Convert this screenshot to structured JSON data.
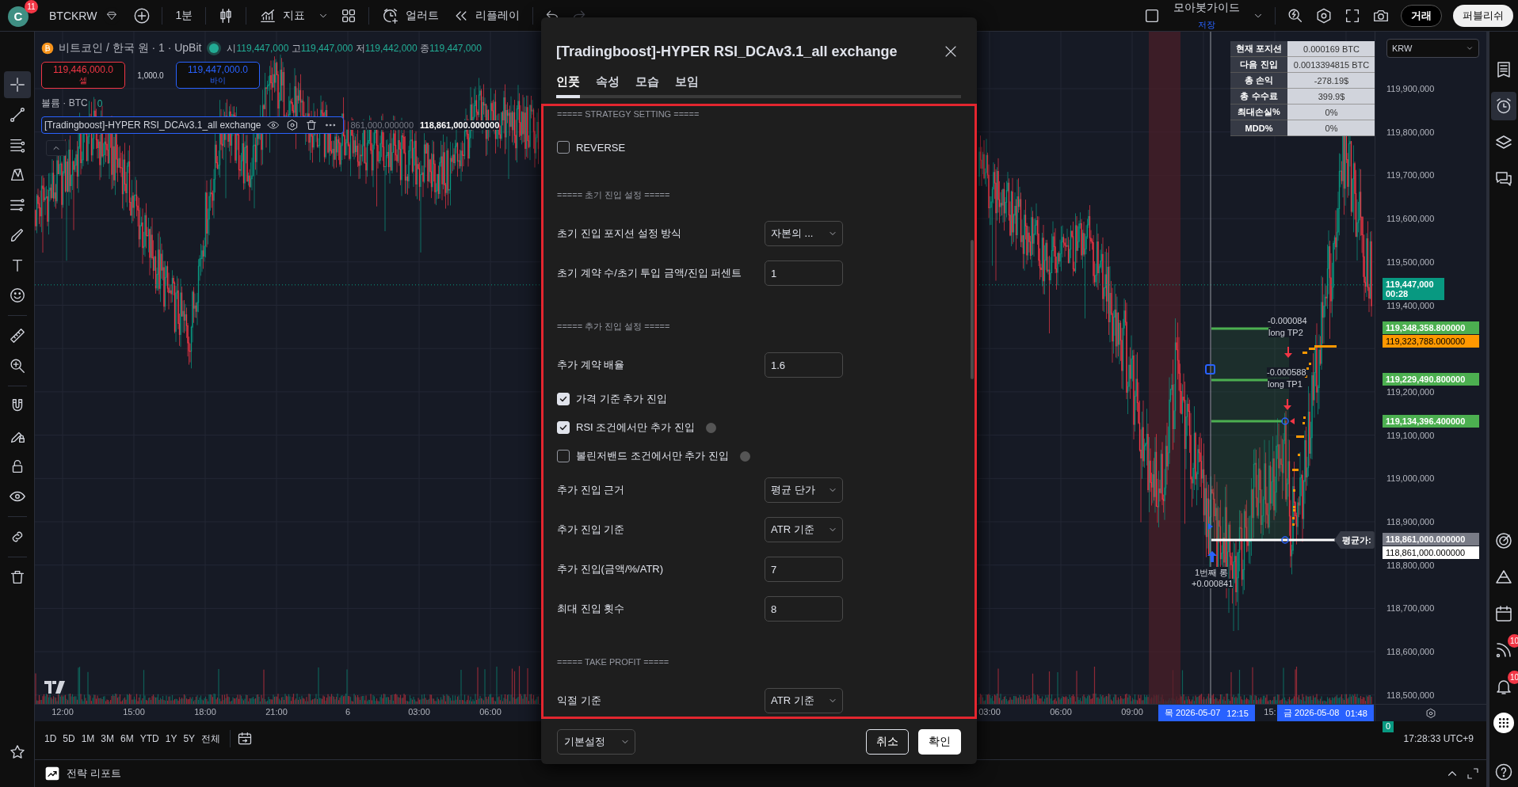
{
  "top_bar": {
    "avatar": "C",
    "avatar_badge": "11",
    "symbol": "BTCKRW",
    "interval": "1분",
    "indicators": "지표",
    "alert": "얼러트",
    "replay": "리플레이",
    "layout_name": "모아봇가이드",
    "save_status": "저장",
    "trade_button": "거래",
    "publish_button": "퍼블리쉬"
  },
  "left_toolbar": [
    {
      "kind": "crosshair",
      "selected": true
    },
    {
      "kind": "trend-line",
      "selected": false
    },
    {
      "kind": "fib",
      "selected": false
    },
    {
      "kind": "pattern",
      "selected": false
    },
    {
      "kind": "forecast",
      "selected": false
    },
    {
      "kind": "brush",
      "selected": false
    },
    {
      "kind": "text",
      "selected": false
    },
    {
      "kind": "emoji",
      "selected": false
    },
    {
      "kind": "ruler",
      "selected": false
    },
    {
      "kind": "zoom",
      "selected": false
    },
    {
      "kind": "magnet",
      "selected": false
    },
    {
      "kind": "lock-draw",
      "selected": false
    },
    {
      "kind": "lock",
      "selected": false
    },
    {
      "kind": "eye",
      "selected": false
    },
    {
      "kind": "link",
      "selected": false
    },
    {
      "kind": "trash",
      "selected": false
    },
    {
      "kind": "star",
      "selected": false
    }
  ],
  "legend": {
    "title": "비트코인 / 한국 원 · 1 · UpBit",
    "ohlc": [
      {
        "label": "시",
        "value": "119,447,000"
      },
      {
        "label": "고",
        "value": "119,447,000"
      },
      {
        "label": "저",
        "value": "119,442,000"
      },
      {
        "label": "종",
        "value": "119,447,000"
      }
    ],
    "sell": {
      "price": "119,446,000.0",
      "label": "셀"
    },
    "spread": "1,000.0",
    "buy": {
      "price": "119,447,000.0",
      "label": "바이"
    },
    "volume": {
      "label": "볼륨 · BTC",
      "value": "0"
    },
    "indicator": {
      "name": "[Tradingboost]-HYPER RSI_DCAv3.1_all exchange",
      "value_1": "861,000.000000",
      "value_2": "118,861,000.000000"
    }
  },
  "position_table": [
    {
      "label": "현재 포지션",
      "value": "0.000169 BTC"
    },
    {
      "label": "다음 진입",
      "value": "0.0013394815 BTC"
    },
    {
      "label": "총 손익",
      "value": "-278.19$"
    },
    {
      "label": "총 수수료",
      "value": "399.9$"
    },
    {
      "label": "최대손실%",
      "value": "0%"
    },
    {
      "label": "MDD%",
      "value": "0%"
    }
  ],
  "chart_marks": {
    "take_profits": [
      {
        "amount": "-0.000084",
        "label": "long TP2"
      },
      {
        "amount": "-0.000588",
        "label": "long TP1"
      }
    ],
    "entry": {
      "title": "1번째 롱",
      "amount": "+0.000841"
    },
    "average_tag": "평균가:"
  },
  "price_axis": {
    "currency": "KRW",
    "ticks": [
      "119,900,000",
      "119,800,000",
      "119,700,000",
      "119,600,000",
      "119,500,000",
      "119,400,000",
      "119,200,000",
      "119,100,000",
      "119,000,000",
      "118,900,000",
      "118,800,000",
      "118,700,000",
      "118,600,000",
      "118,500,000"
    ],
    "tags": [
      {
        "kind": "last",
        "price": "119,447,000",
        "countdown": "00:28"
      },
      {
        "kind": "profit",
        "price": "119,348,358.800000"
      },
      {
        "kind": "order",
        "price": "119,323,788.000000"
      },
      {
        "kind": "profit",
        "price": "119,229,490.800000"
      },
      {
        "kind": "profit",
        "price": "119,134,396.400000"
      },
      {
        "kind": "average",
        "price": "118,861,000.000000"
      },
      {
        "kind": "plain",
        "price": "118,861,000.000000"
      }
    ],
    "volume_tag": "0"
  },
  "time_axis": {
    "ticks": [
      "12:00",
      "15:00",
      "18:00",
      "21:00",
      "6",
      "03:00",
      "06:00",
      "03:00",
      "06:00",
      "09:00"
    ],
    "partial_tick": "15:",
    "cursors": [
      {
        "day": "목",
        "date": "2026-05-07",
        "time": "12:15"
      },
      {
        "day": "금",
        "date": "2026-05-08",
        "time": "01:48"
      }
    ]
  },
  "ranges": [
    "1D",
    "5D",
    "1M",
    "3M",
    "6M",
    "YTD",
    "1Y",
    "5Y",
    "전체"
  ],
  "clock": "17:28:33 UTC+9",
  "bottom_panel": {
    "title": "전략 리포트"
  },
  "right_toolbar": [
    {
      "kind": "watchlist",
      "selected": false
    },
    {
      "kind": "alerts",
      "selected": true
    },
    {
      "kind": "layers",
      "selected": false
    },
    {
      "kind": "chat",
      "selected": false
    },
    {
      "kind": "target",
      "selected": false
    },
    {
      "kind": "triangles",
      "selected": false
    },
    {
      "kind": "calendar",
      "selected": false
    },
    {
      "kind": "signal",
      "selected": false,
      "badge": "10"
    },
    {
      "kind": "bell",
      "selected": false,
      "badge": "10"
    },
    {
      "kind": "apps",
      "selected": false
    },
    {
      "kind": "help",
      "selected": false
    }
  ],
  "dialog": {
    "title": "[Tradingboost]-HYPER RSI_DCAv3.1_all exchange",
    "tabs": [
      {
        "label": "인풋",
        "selected": true
      },
      {
        "label": "속성",
        "selected": false
      },
      {
        "label": "모습",
        "selected": false
      },
      {
        "label": "보임",
        "selected": false
      }
    ],
    "inputs": [
      {
        "kind": "section",
        "text": "===== STRATEGY SETTING ====="
      },
      {
        "kind": "checkbox",
        "label": "REVERSE",
        "checked": false,
        "info": false
      },
      {
        "kind": "section",
        "text": "===== 초기 진입 설정 ====="
      },
      {
        "kind": "select",
        "label": "초기 진입 포지션 설정 방식",
        "value": "자본의 ..."
      },
      {
        "kind": "number",
        "label": "초기 계약 수/초기 투입 금액/진입 퍼센트",
        "value": "1"
      },
      {
        "kind": "section",
        "text": "===== 추가 진입 설정 ====="
      },
      {
        "kind": "number",
        "label": "추가 계약 배율",
        "value": "1.6"
      },
      {
        "kind": "checkbox",
        "label": "가격 기준 추가 진입",
        "checked": true,
        "info": false
      },
      {
        "kind": "checkbox",
        "label": "RSI 조건에서만 추가 진입",
        "checked": true,
        "info": true
      },
      {
        "kind": "checkbox",
        "label": "볼린저밴드 조건에서만 추가 진입",
        "checked": false,
        "info": true
      },
      {
        "kind": "select",
        "label": "추가 진입 근거",
        "value": "평균 단가"
      },
      {
        "kind": "select",
        "label": "추가 진입 기준",
        "value": "ATR 기준"
      },
      {
        "kind": "number",
        "label": "추가 진입(금액/%/ATR)",
        "value": "7"
      },
      {
        "kind": "number",
        "label": "최대 진입 횟수",
        "value": "8"
      },
      {
        "kind": "section",
        "text": "===== TAKE PROFIT ====="
      },
      {
        "kind": "select",
        "label": "익절 기준",
        "value": "ATR 기준"
      }
    ],
    "defaults": "기본설정",
    "cancel": "취소",
    "ok": "확인"
  }
}
